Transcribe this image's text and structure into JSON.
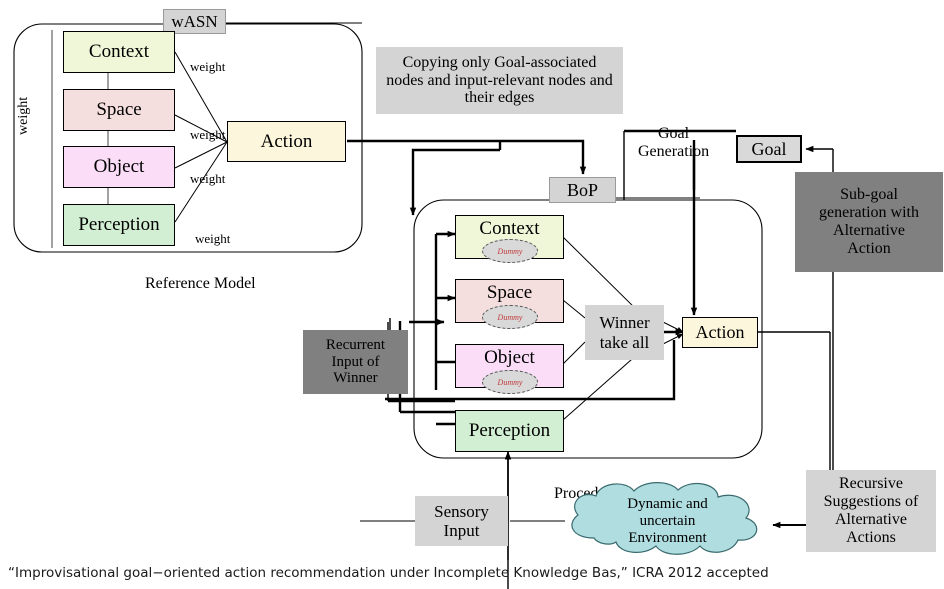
{
  "diagram": {
    "title_caption": "“Improvisational  goal−oriented  action recommendation  under Incomplete  Knowledge  Bas,” ICRA 2012 accepted",
    "colors": {
      "context": "#f0f7d8",
      "space": "#f5dede",
      "object": "#fbddf7",
      "perception": "#d3efd3",
      "action": "#fbf6dc",
      "gray_light": "#d4d4d4",
      "gray_dark": "#808080",
      "goal": "#d9d9d9",
      "cloud": "#b0dde0",
      "dummy_text": "#c03a3a",
      "stroke": "#000000"
    }
  },
  "reference_model": {
    "badge": "wASN",
    "caption": "Reference Model",
    "side_label": "weight",
    "nodes": [
      {
        "label": "Context"
      },
      {
        "label": "Space"
      },
      {
        "label": "Object"
      },
      {
        "label": "Perception"
      }
    ],
    "edge_labels": [
      "weight",
      "weight",
      "weight",
      "weight"
    ],
    "action": "Action"
  },
  "annotations": {
    "copying": "Copying only Goal-associated nodes and  input-relevant nodes and their edges",
    "goal_generation": "Goal\nGeneration"
  },
  "procedural_model": {
    "caption": "Procedural Model",
    "bop": "BoP",
    "nodes": [
      {
        "label": "Context",
        "dummy": "Dummy"
      },
      {
        "label": "Space",
        "dummy": "Dummy"
      },
      {
        "label": "Object",
        "dummy": "Dummy"
      },
      {
        "label": "Perception",
        "dummy": null
      }
    ],
    "winner": "Winner\ntake all",
    "action": "Action",
    "recurrent": "Recurrent\nInput of\nWinner"
  },
  "right_column": {
    "goal": "Goal",
    "subgoal": "Sub-goal\ngeneration with\nAlternative\nAction",
    "recursive": "Recursive\nSuggestions of\nAlternative\nActions"
  },
  "bottom": {
    "sensory": "Sensory\nInput",
    "environment": "Dynamic and\nuncertain\nEnvironment"
  }
}
